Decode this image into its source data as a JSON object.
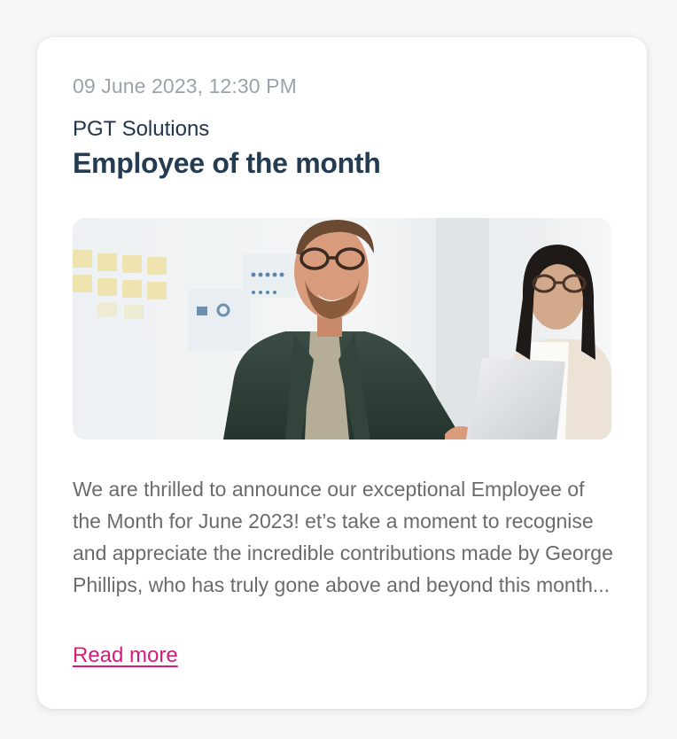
{
  "post": {
    "date": "09 June 2023, 12:30 PM",
    "company": "PGT Solutions",
    "title": "Employee of the month",
    "image_alt": "Smiling man with glasses and colleague in office",
    "body": "We are thrilled to announce our exceptional Employee of the Month for June 2023!  et’s take a moment to recognise and appreciate the incredible contributions made by George Phillips, who has truly gone above and beyond this month...",
    "read_more_label": "Read more"
  },
  "colors": {
    "title": "#243b52",
    "date": "#9aa3ad",
    "body": "#6b6b6b",
    "link": "#d81b7a"
  }
}
